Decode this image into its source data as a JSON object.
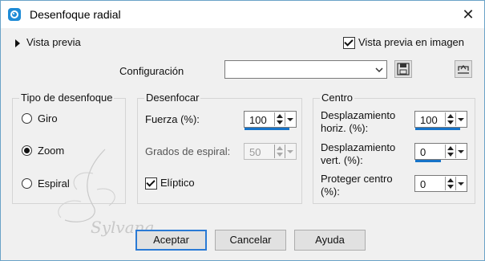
{
  "window": {
    "title": "Desenfoque radial",
    "close_glyph": "✕"
  },
  "preview": {
    "toggle_label": "Vista previa",
    "image_preview_label": "Vista previa en imagen",
    "image_preview_checked": true
  },
  "presets": {
    "label": "Configuración",
    "value": "",
    "save_icon": "save-icon",
    "reset_icon": "reset-icon"
  },
  "blur_type": {
    "title": "Tipo de desenfoque",
    "options": [
      {
        "label": "Giro",
        "checked": false
      },
      {
        "label": "Zoom",
        "checked": true
      },
      {
        "label": "Espiral",
        "checked": false
      }
    ]
  },
  "blur": {
    "title": "Desenfocar",
    "strength_label": "Fuerza (%):",
    "strength_value": "100",
    "twist_label": "Grados de espiral:",
    "twist_value": "50",
    "elliptical_label": "Elíptico",
    "elliptical_checked": true
  },
  "center": {
    "title": "Centro",
    "h_offset_label_1": "Desplazamiento",
    "h_offset_label_2": "horiz. (%):",
    "h_offset_value": "100",
    "v_offset_label_1": "Desplazamiento",
    "v_offset_label_2": "vert. (%):",
    "v_offset_value": "0",
    "protect_label_1": "Proteger centro",
    "protect_label_2": "(%):",
    "protect_value": "0"
  },
  "buttons": {
    "ok": "Aceptar",
    "cancel": "Cancelar",
    "help": "Ayuda"
  },
  "watermark": "Sylvana",
  "colors": {
    "accent": "#1673c8",
    "icon_blue": "#1e8bd6"
  }
}
